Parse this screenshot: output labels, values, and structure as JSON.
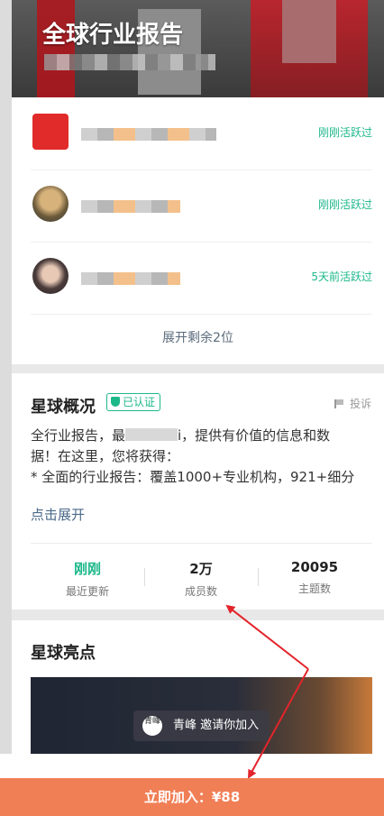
{
  "hero": {
    "title": "全球行业报告"
  },
  "members": [
    {
      "status": "刚刚活跃过"
    },
    {
      "status": "刚刚活跃过"
    },
    {
      "status": "5天前活跃过"
    }
  ],
  "members_expand": "展开剩余2位",
  "overview": {
    "title": "星球概况",
    "verified": "已认证",
    "report": "投诉",
    "desc_line1": "全行业报告，最",
    "desc_line1b": "i，提供有价值的信息和数",
    "desc_line2": "据！在这里，您将获得：",
    "desc_line3": "*  全面的行业报告：覆盖1000+专业机构，921+细分",
    "expand": "点击展开",
    "stats": [
      {
        "value": "刚刚",
        "label": "最近更新"
      },
      {
        "value": "2万",
        "label": "成员数"
      },
      {
        "value": "20095",
        "label": "主题数"
      }
    ]
  },
  "highlights": {
    "title": "星球亮点"
  },
  "toast": {
    "avatar_text": "青峰",
    "text": "青峰 邀请你加入"
  },
  "join": {
    "label": "立即加入：¥88"
  },
  "colors": {
    "accent": "#1db88a",
    "join": "#f07f56",
    "arrow": "#e3242b"
  }
}
